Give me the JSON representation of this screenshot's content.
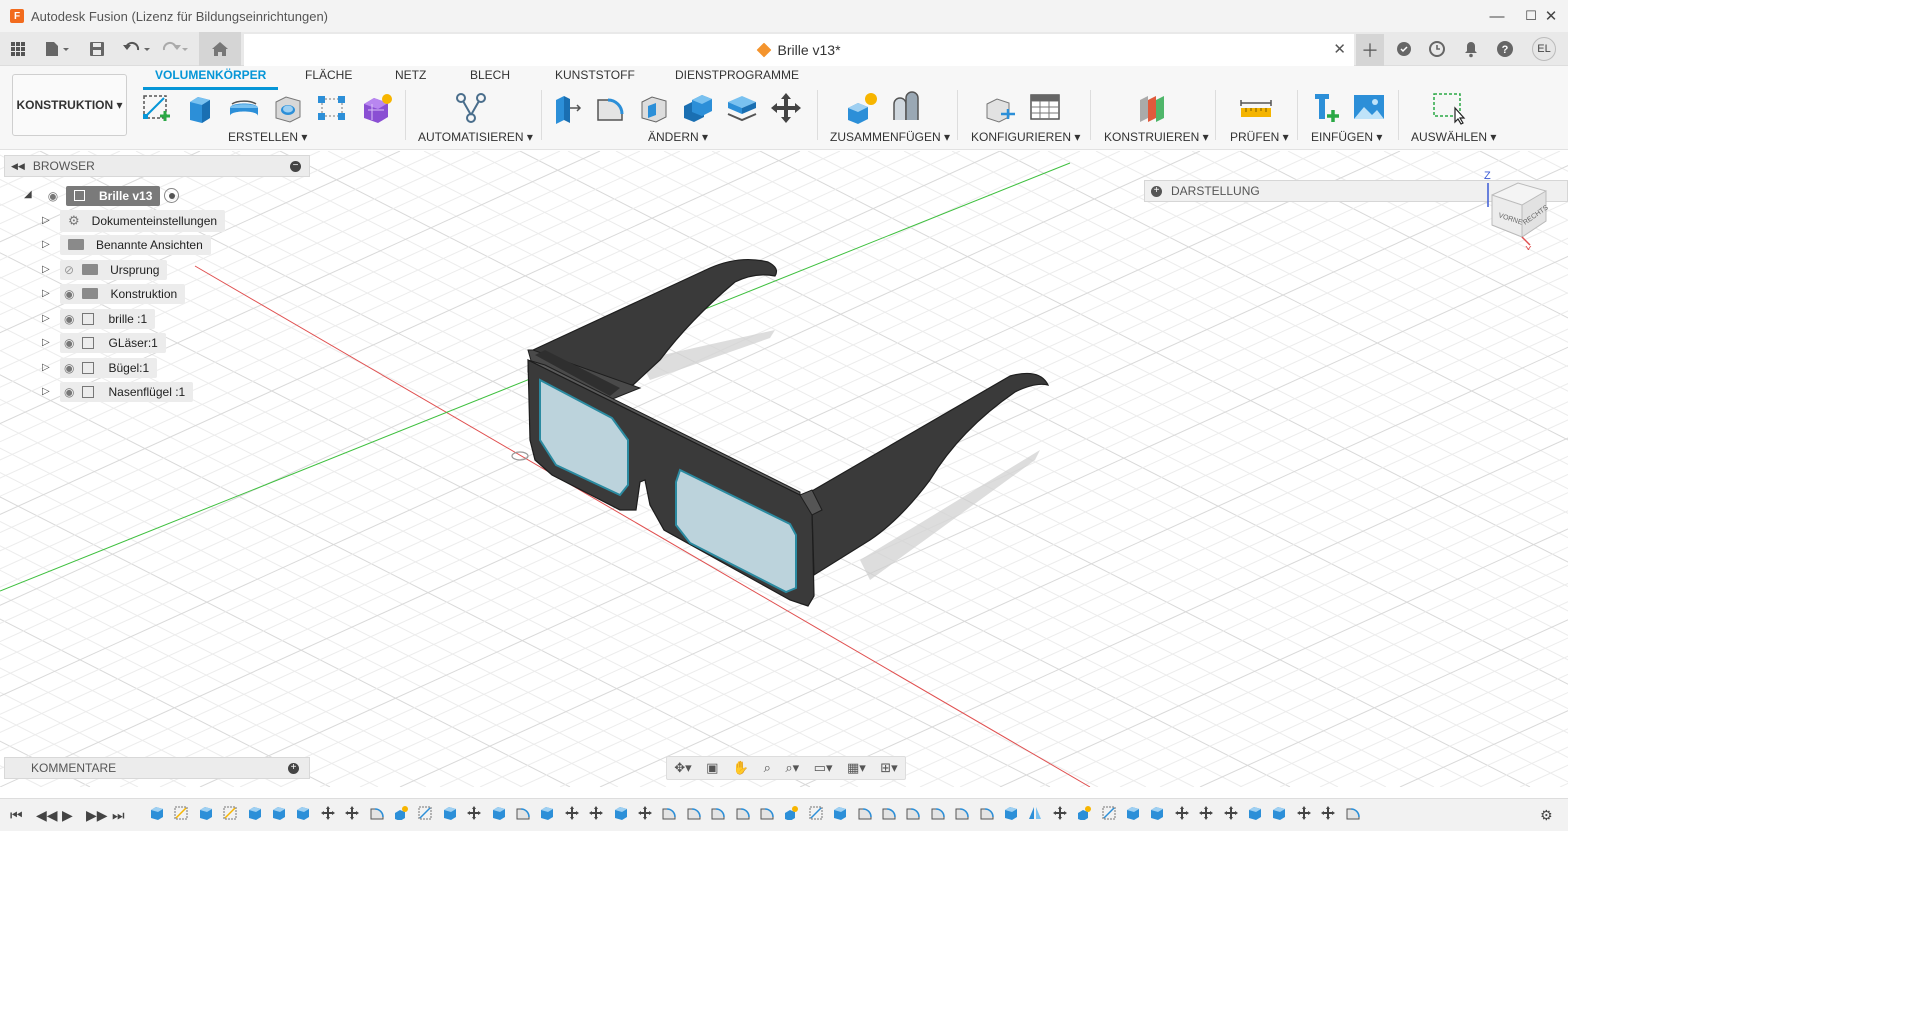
{
  "app": {
    "title": "Autodesk Fusion (Lizenz für Bildungseinrichtungen)",
    "logo": "F"
  },
  "tab": {
    "document_title": "Brille v13*",
    "avatar": "EL"
  },
  "workspace": {
    "label": "KONSTRUKTION ▾"
  },
  "ribbon": {
    "tabs": [
      "VOLUMENKÖRPER",
      "FLÄCHE",
      "NETZ",
      "BLECH",
      "KUNSTSTOFF",
      "DIENSTPROGRAMME"
    ],
    "active_tab": "VOLUMENKÖRPER",
    "groups": [
      "ERSTELLEN ▾",
      "AUTOMATISIEREN ▾",
      "ÄNDERN ▾",
      "ZUSAMMENFÜGEN ▾",
      "KONFIGURIEREN ▾",
      "KONSTRUIEREN ▾",
      "PRÜFEN ▾",
      "EINFÜGEN ▾",
      "AUSWÄHLEN ▾"
    ]
  },
  "browser": {
    "title": "BROWSER",
    "root": "Brille v13",
    "items": [
      "Dokumenteinstellungen",
      "Benannte Ansichten",
      "Ursprung",
      "Konstruktion",
      "brille :1",
      "GLäser:1",
      "Bügel:1",
      "Nasenflügel :1"
    ]
  },
  "panels": {
    "darstellung": "DARSTELLUNG",
    "kommentare": "KOMMENTARE"
  },
  "viewcube": {
    "axis_z": "Z",
    "axis_x": "X",
    "face_front": "VORNE",
    "face_right": "RECHTS"
  },
  "colors": {
    "accent": "#0696d7",
    "frame": "#3e3e3e",
    "lens": "#bcd3dc",
    "lens_edge": "#2b8aa0",
    "x_axis": "#e05050",
    "y_axis": "#40c040",
    "logo": "#f26b1d"
  }
}
